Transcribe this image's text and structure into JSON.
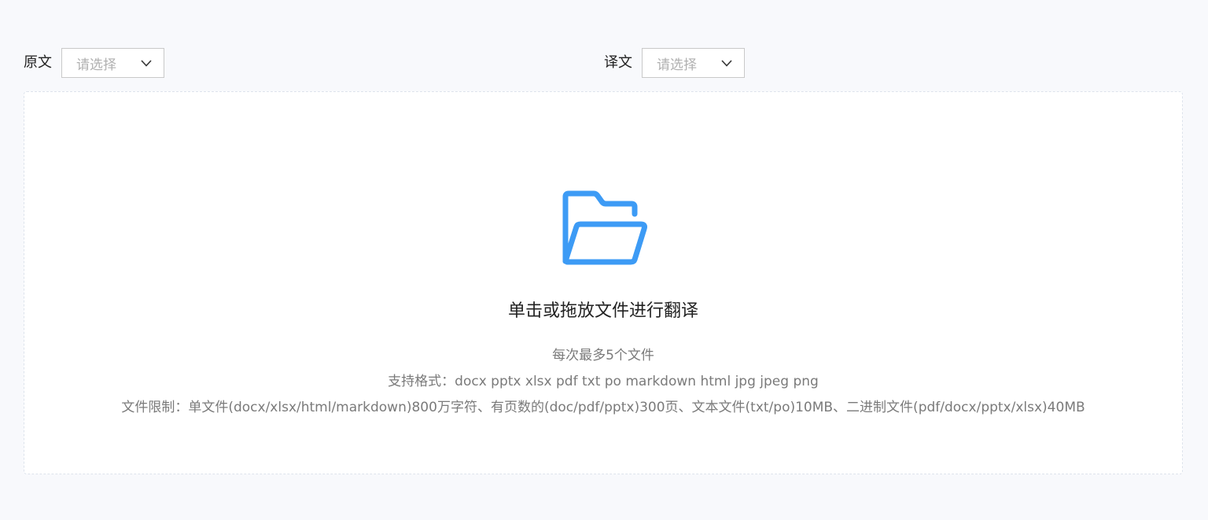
{
  "source": {
    "label": "原文",
    "placeholder": "请选择"
  },
  "target": {
    "label": "译文",
    "placeholder": "请选择"
  },
  "icons": {
    "dropdown": "chevron-down-icon",
    "upload": "folder-open-icon"
  },
  "upload": {
    "title": "单击或拖放文件进行翻译",
    "max_files": "每次最多5个文件",
    "formats": "支持格式：docx pptx xlsx pdf txt po markdown html jpg jpeg png",
    "limits": "文件限制：单文件(docx/xlsx/html/markdown)800万字符、有页数的(doc/pdf/pptx)300页、文本文件(txt/po)10MB、二进制文件(pdf/docx/pptx/xlsx)40MB"
  },
  "colors": {
    "accent": "#3d9bf5",
    "background": "#f8f9fc"
  }
}
